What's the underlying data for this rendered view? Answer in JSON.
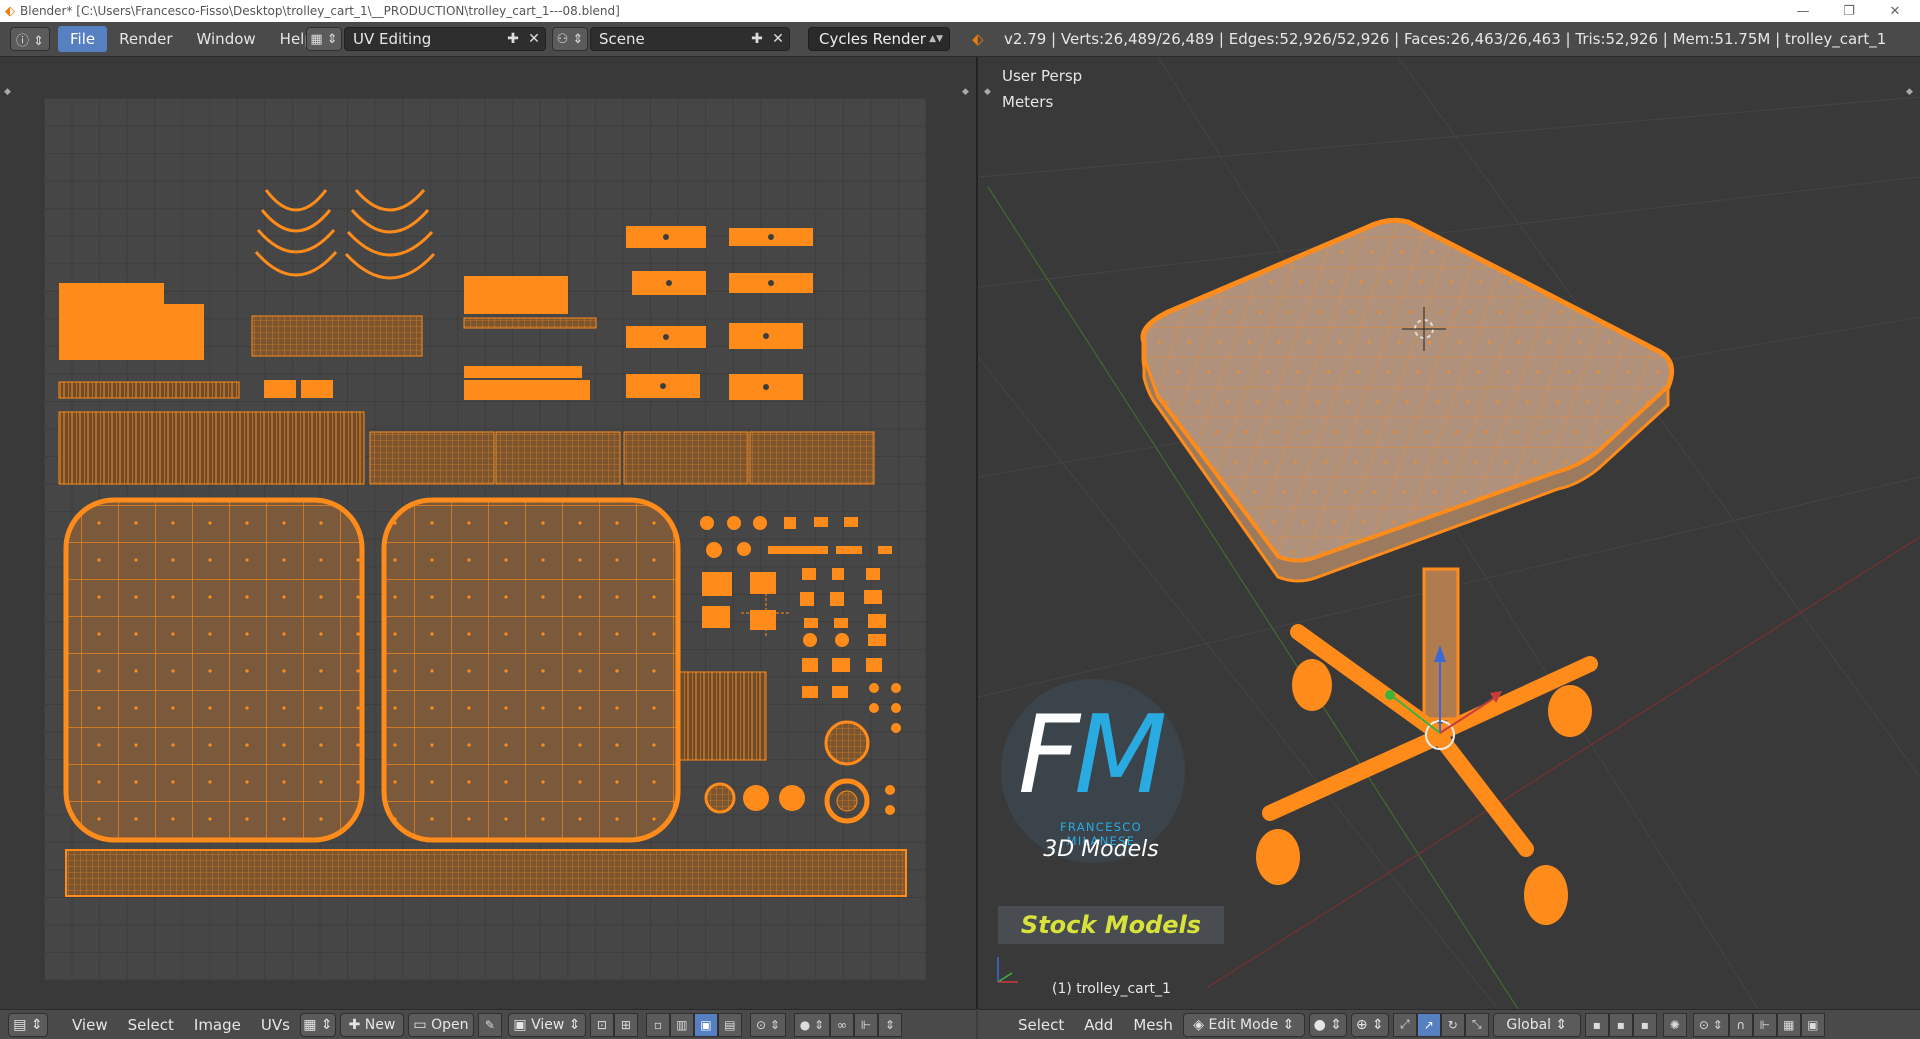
{
  "titlebar": {
    "title": "Blender* [C:\\Users\\Francesco-Fisso\\Desktop\\trolley_cart_1\\__PRODUCTION\\trolley_cart_1---08.blend]",
    "minimize": "—",
    "restore": "❐",
    "close": "✕"
  },
  "infobar": {
    "menus": [
      "File",
      "Render",
      "Window",
      "Help"
    ],
    "active_menu": "File",
    "screen_layout": "UV Editing",
    "scene": "Scene",
    "render_engine": "Cycles Render",
    "stats": "v2.79 | Verts:26,489/26,489 | Edges:52,926/52,926 | Faces:26,463/26,463 | Tris:52,926 | Mem:51.75M | trolley_cart_1"
  },
  "viewport": {
    "view_label": "User Persp",
    "units_label": "Meters",
    "object_label": "(1) trolley_cart_1"
  },
  "uv_footer": {
    "menus": [
      "View",
      "Select",
      "Image",
      "UVs"
    ],
    "new_label": "New",
    "open_label": "Open",
    "view_label": "View"
  },
  "vp_footer": {
    "menus": [
      "Select",
      "Add",
      "Mesh"
    ],
    "mode": "Edit Mode",
    "orientation": "Global"
  },
  "watermark": {
    "logo_f": "F",
    "logo_m": "M",
    "brand": "FRANCESCO MILANESE",
    "subtitle": "3D Models",
    "badge": "Stock Models"
  },
  "colors": {
    "uv_orange": "#ff8c1a",
    "accent_blue": "#5680c2",
    "header_bg": "#4a4a4a",
    "editor_bg": "#393939"
  },
  "icons": [
    "blender-logo-icon",
    "info-editor-icon",
    "screen-layout-icon",
    "scene-icon",
    "plus-icon",
    "close-icon",
    "render-icon",
    "editor-type-icon",
    "cursor-icon"
  ]
}
